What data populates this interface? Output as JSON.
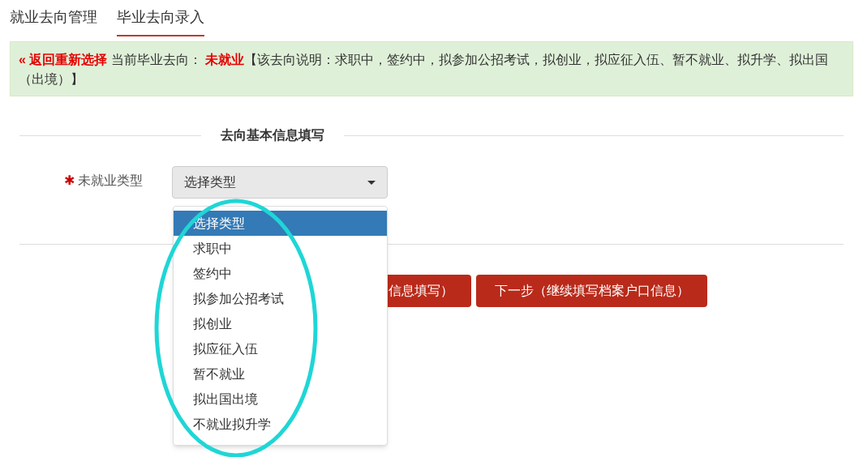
{
  "tabs": [
    {
      "label": "就业去向管理",
      "selected": false
    },
    {
      "label": "毕业去向录入",
      "selected": true
    }
  ],
  "notice": {
    "back_link": "« 返回重新选择",
    "current_label": "当前毕业去向：",
    "current_value": "未就业",
    "description": "【该去向说明：求职中，签约中，拟参加公招考试，拟创业，拟应征入伍、暂不就业、拟升学、拟出国（出境）】"
  },
  "section_title": "去向基本信息填写",
  "field": {
    "required_mark": "✱",
    "label": "未就业类型",
    "value": "选择类型",
    "expanded": true,
    "options": [
      {
        "label": "选择类型",
        "selected": true
      },
      {
        "label": "求职中",
        "selected": false
      },
      {
        "label": "签约中",
        "selected": false
      },
      {
        "label": "拟参加公招考试",
        "selected": false
      },
      {
        "label": "拟创业",
        "selected": false
      },
      {
        "label": "拟应征入伍",
        "selected": false
      },
      {
        "label": "暂不就业",
        "selected": false
      },
      {
        "label": "拟出国出境",
        "selected": false
      },
      {
        "label": "不就业拟升学",
        "selected": false
      }
    ]
  },
  "buttons": [
    "信息填写）",
    "下一步（继续填写档案户口信息）"
  ]
}
